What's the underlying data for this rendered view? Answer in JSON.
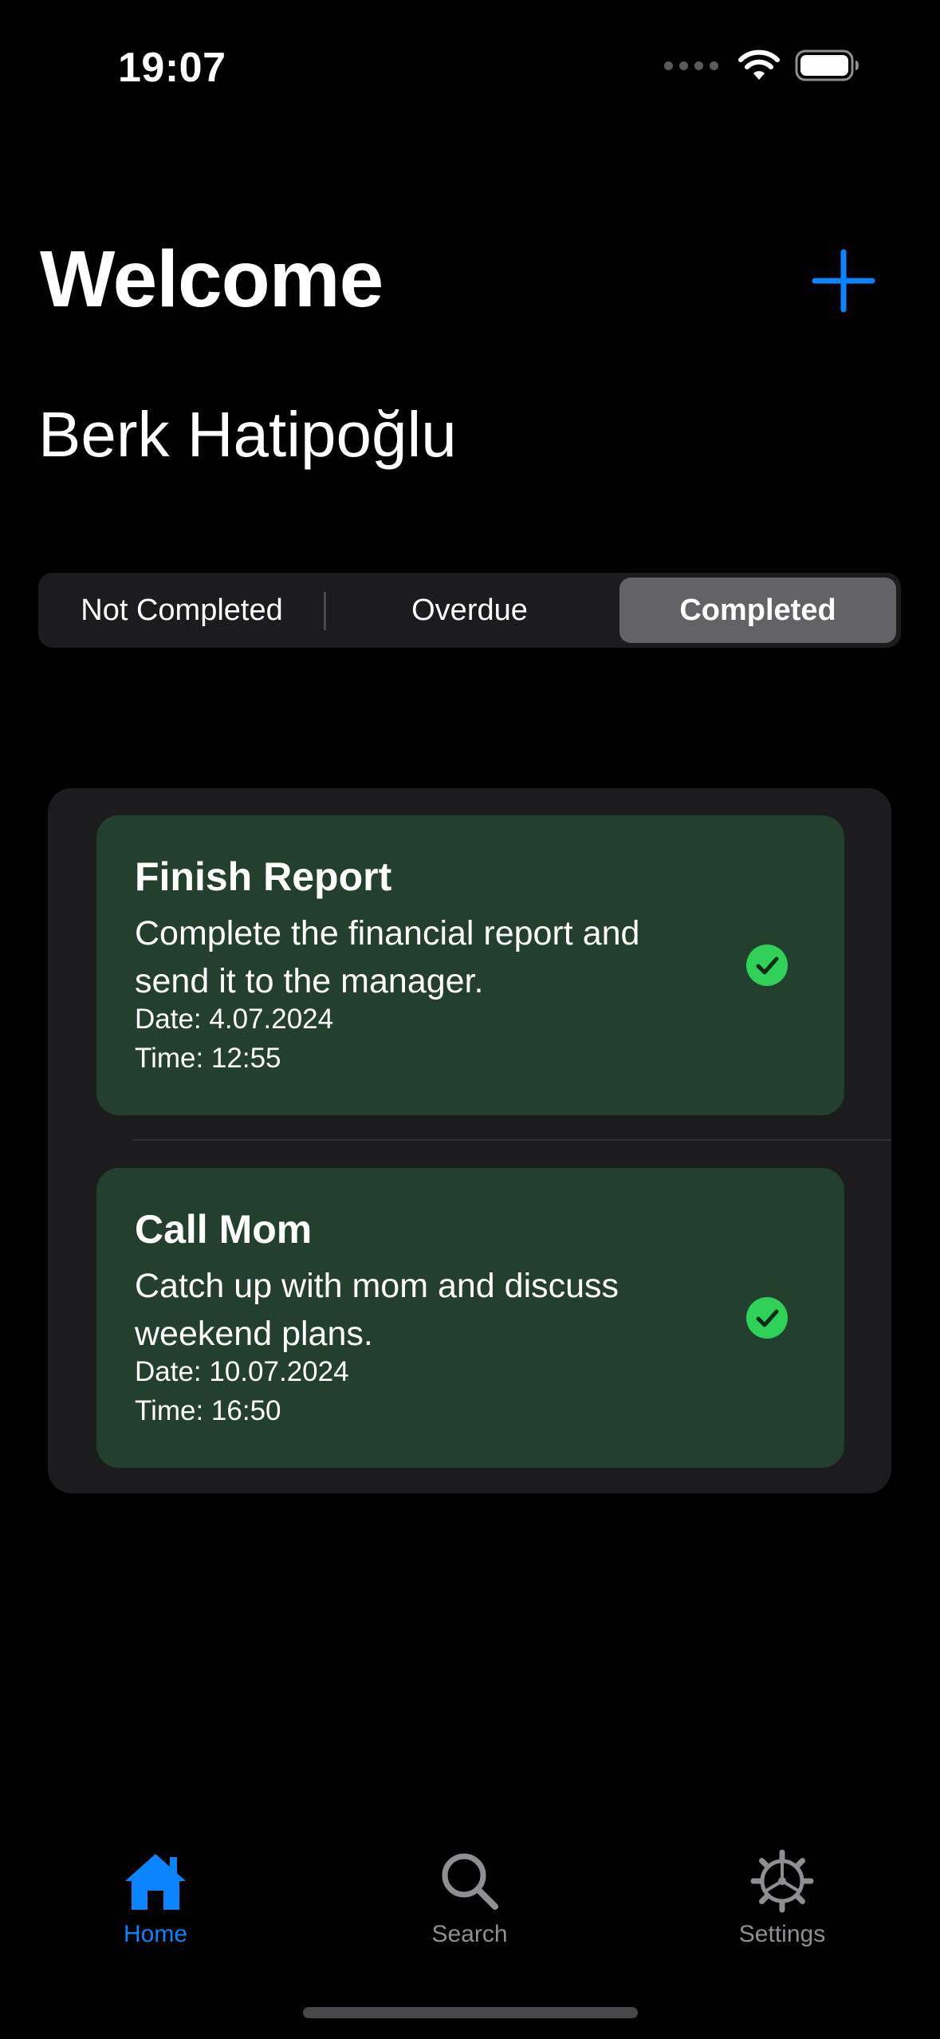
{
  "status_bar": {
    "time": "19:07",
    "icons": [
      "signal-dots",
      "wifi-icon",
      "battery-icon"
    ]
  },
  "header": {
    "title": "Welcome",
    "user_name": "Berk Hatipoğlu",
    "add_icon": "plus-icon"
  },
  "segments": {
    "items": [
      {
        "label": "Not Completed",
        "selected": false
      },
      {
        "label": "Overdue",
        "selected": false
      },
      {
        "label": "Completed",
        "selected": true
      }
    ]
  },
  "tasks": [
    {
      "title": "Finish Report",
      "description": "Complete the financial report and send it to the manager.",
      "date": "Date: 4.07.2024",
      "time": "Time: 12:55",
      "status_icon": "checkmark-circle-icon"
    },
    {
      "title": "Call Mom",
      "description": "Catch up with mom and discuss weekend plans.",
      "date": "Date: 10.07.2024",
      "time": "Time: 16:50",
      "status_icon": "checkmark-circle-icon"
    }
  ],
  "tab_bar": {
    "items": [
      {
        "label": "Home",
        "icon": "house-icon",
        "active": true
      },
      {
        "label": "Search",
        "icon": "magnifier-icon",
        "active": false
      },
      {
        "label": "Settings",
        "icon": "gear-icon",
        "active": false
      }
    ]
  },
  "colors": {
    "background": "#000000",
    "accent": "#0a84ff",
    "card_completed": "#22402d",
    "check_green": "#30d158",
    "segment_selected": "#636366",
    "list_background": "#1c1c1e",
    "inactive_tab": "#8e8e93"
  }
}
